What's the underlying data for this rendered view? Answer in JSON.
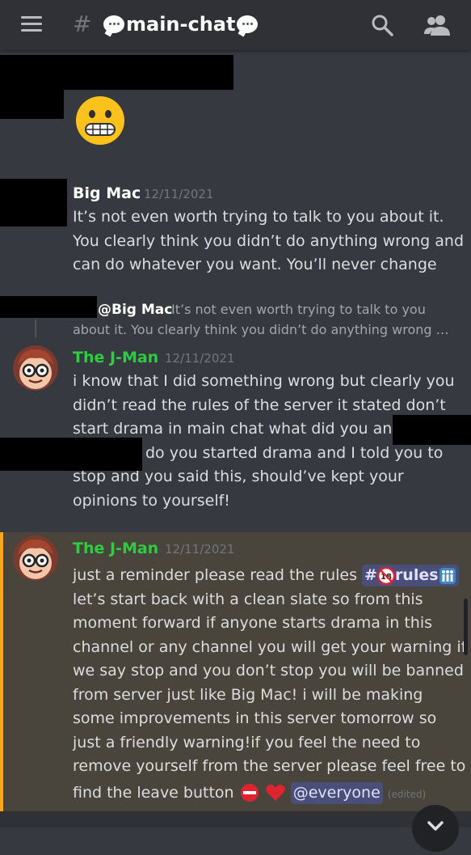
{
  "header": {
    "channel_prefix": "#",
    "channel_name": "main-chat"
  },
  "messages": [
    {
      "author": "Big Mac",
      "timestamp": "12/11/2021",
      "lines": [
        "It’s not even worth trying to talk to you about it.",
        "You clearly think you didn’t do anything wrong and",
        "can do whatever you want. You’ll never change"
      ]
    },
    {
      "reply": {
        "author": "@Big Mac",
        "preview_line1": "It’s not even worth trying to talk to you",
        "preview_line2": "about it. You clearly think you didn’t do anything wrong …"
      },
      "author": "The J-Man",
      "timestamp": "12/11/2021",
      "lines": [
        "i know that I did something wrong but clearly you",
        "didn’t read the rules of the server it stated don’t",
        "start drama in main chat what did you and",
        "do you started drama and I told you to",
        "stop and you said this, should’ve kept your",
        "opinions to yourself!"
      ]
    },
    {
      "author": "The J-Man",
      "timestamp": "12/11/2021",
      "line1_prefix": "just a reminder please read the rules ",
      "channel_mention": {
        "hash": "#",
        "name": "rules"
      },
      "lines": [
        "let’s start back with a clean slate so from this",
        "moment forward if anyone starts drama in this",
        "channel or any channel you will get your warning if",
        "we say stop and you don’t stop you will be banned",
        "from server just like Big Mac! i will be making",
        "some improvements in this server tomorrow so",
        "just a friendly warning!if you feel the need to",
        "remove yourself from the server please feel free to"
      ],
      "last_line_prefix": "find the leave button",
      "everyone_mention": "@everyone",
      "edited": "(edited)"
    }
  ],
  "colors": {
    "background": "#36393f",
    "header": "#2f3136",
    "jman_name": "#2ecc40",
    "highlight_bg": "#49443c",
    "highlight_bar": "#faa61a",
    "mention_bg": "#4a4f79"
  },
  "icons": [
    "hamburger-icon",
    "search-icon",
    "members-icon",
    "chevron-down-icon"
  ]
}
